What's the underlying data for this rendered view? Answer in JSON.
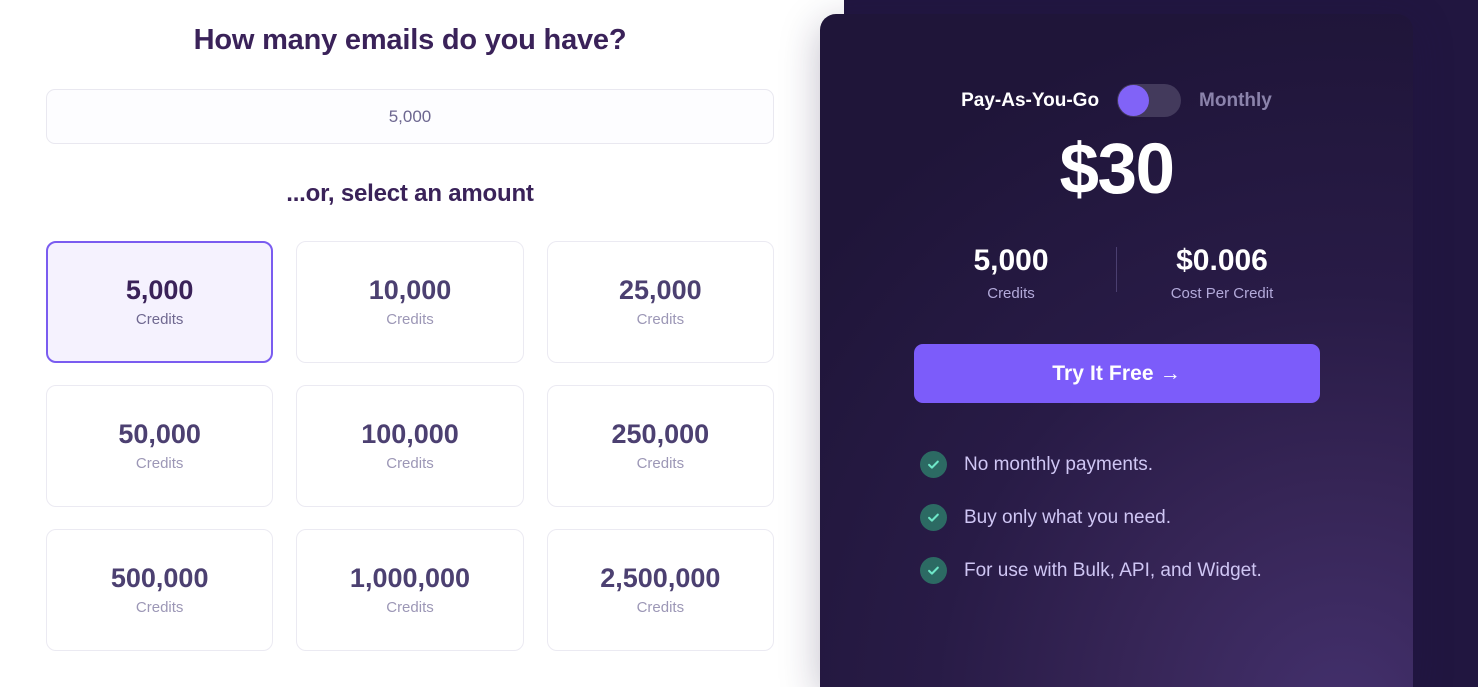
{
  "calculator": {
    "heading": "How many emails do you have?",
    "email_input": {
      "value": "5,000",
      "placeholder": "5,000"
    },
    "subheading": "...or, select an amount",
    "credit_label": "Credits",
    "options": [
      {
        "amount": "5,000",
        "label": "Credits",
        "selected": true
      },
      {
        "amount": "10,000",
        "label": "Credits",
        "selected": false
      },
      {
        "amount": "25,000",
        "label": "Credits",
        "selected": false
      },
      {
        "amount": "50,000",
        "label": "Credits",
        "selected": false
      },
      {
        "amount": "100,000",
        "label": "Credits",
        "selected": false
      },
      {
        "amount": "250,000",
        "label": "Credits",
        "selected": false
      },
      {
        "amount": "500,000",
        "label": "Credits",
        "selected": false
      },
      {
        "amount": "1,000,000",
        "label": "Credits",
        "selected": false
      },
      {
        "amount": "2,500,000",
        "label": "Credits",
        "selected": false
      }
    ]
  },
  "plan": {
    "billing": {
      "option_left": "Pay-As-You-Go",
      "option_right": "Monthly",
      "selected": "Pay-As-You-Go",
      "knob_position": "left"
    },
    "price": "$30",
    "stats": [
      {
        "value": "5,000",
        "label": "Credits"
      },
      {
        "value": "$0.006",
        "label": "Cost Per Credit"
      }
    ],
    "cta": {
      "label": "Try It Free",
      "arrow": "→"
    },
    "features": [
      {
        "icon": "check-circle-icon",
        "text": "No monthly payments."
      },
      {
        "icon": "check-circle-icon",
        "text": "Buy only what you need."
      },
      {
        "icon": "check-circle-icon",
        "text": "For use with Bulk, API, and Widget."
      }
    ]
  },
  "colors": {
    "accent_purple": "#7c5cfa",
    "selected_border": "#7a5cf0",
    "selected_fill": "#f5f2fe",
    "heading_text": "#3a2259",
    "panel_dark": "#211640",
    "check_green": "#6ee7c8",
    "check_badge": "#2c6a63"
  }
}
